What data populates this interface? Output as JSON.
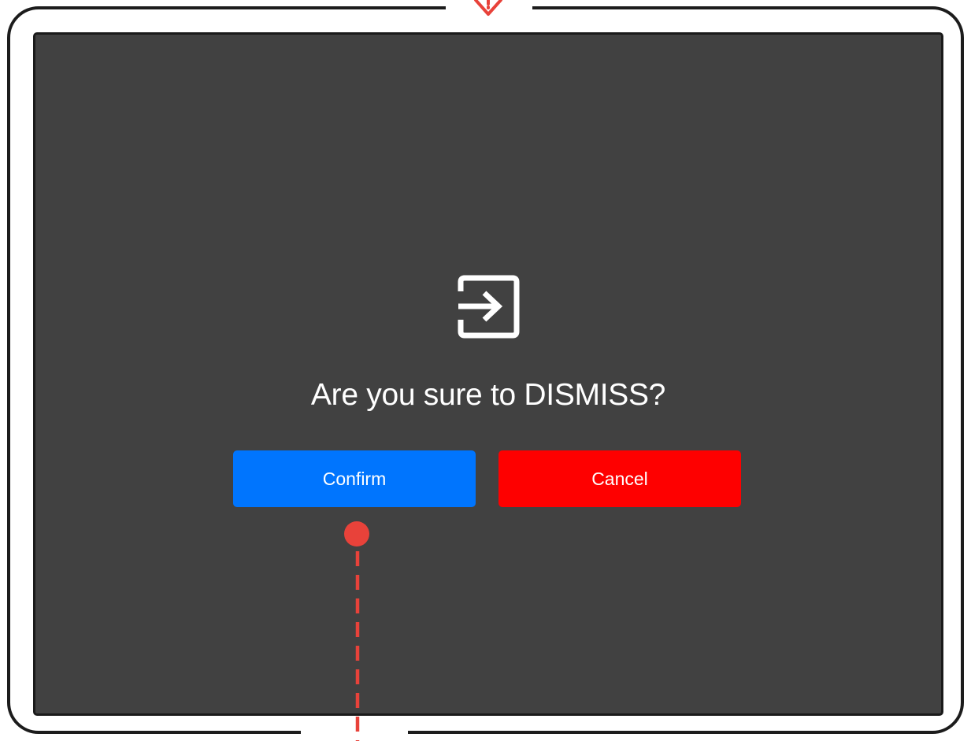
{
  "dialog": {
    "icon": "sign-in-arrow-icon",
    "message": "Are you sure to DISMISS?",
    "confirm_label": "Confirm",
    "cancel_label": "Cancel"
  },
  "colors": {
    "screen_bg": "#414141",
    "confirm": "#0075fe",
    "cancel": "#fe0000",
    "gesture_marker": "#e8423a",
    "device_frame": "#1c1c1c"
  },
  "gesture": {
    "marker_icon": "tap-point-icon",
    "trail_icon": "swipe-trail-icon",
    "edge_arrow_icon": "swipe-down-arrow-icon"
  }
}
